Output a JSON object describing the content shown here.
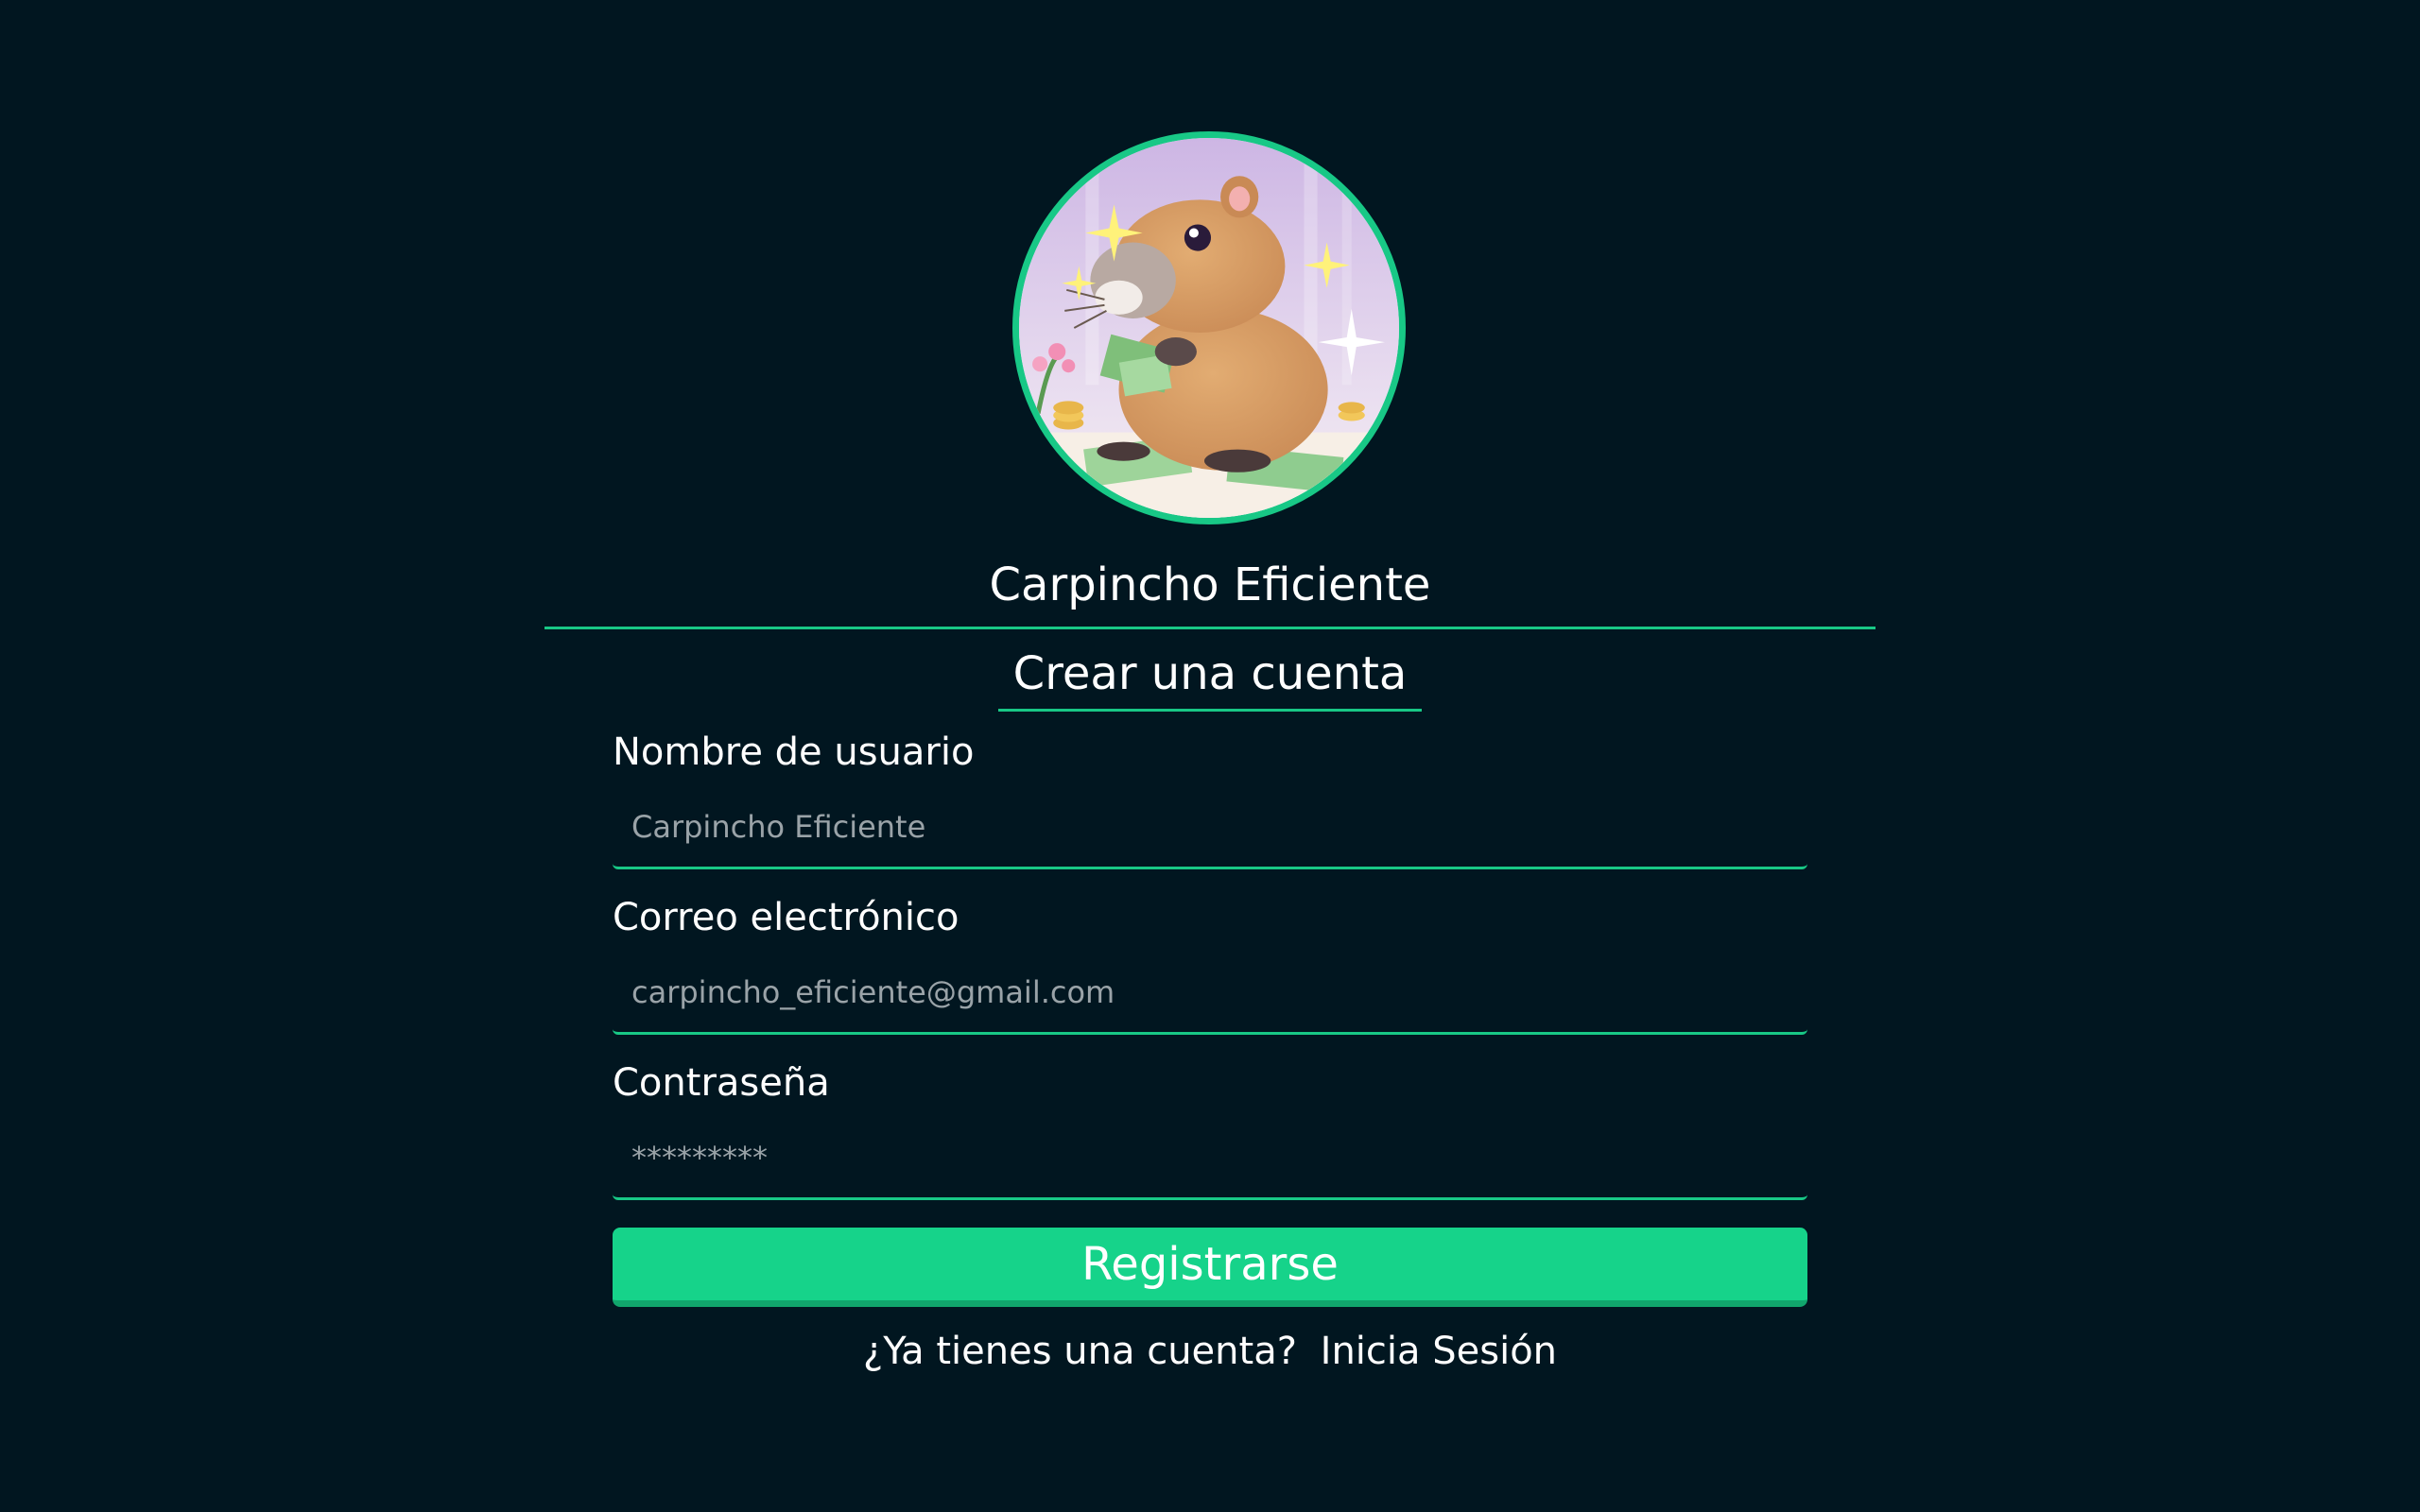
{
  "branding": {
    "avatar_icon": "capybara-counting-money-illustration",
    "app_name": "Carpincho Eficiente",
    "accent_color": "#18c886",
    "background_color": "#011620"
  },
  "form": {
    "heading": "Crear una cuenta",
    "username": {
      "label": "Nombre de usuario",
      "placeholder": "Carpincho Eficiente"
    },
    "email": {
      "label": "Correo electrónico",
      "placeholder": "carpincho_eficiente@gmail.com"
    },
    "password": {
      "label": "Contraseña",
      "placeholder": "*********"
    },
    "submit_label": "Registrarse",
    "button_color": "#16d38a"
  },
  "footer": {
    "prompt": "¿Ya tienes una cuenta?",
    "login_link": "Inicia Sesión"
  }
}
